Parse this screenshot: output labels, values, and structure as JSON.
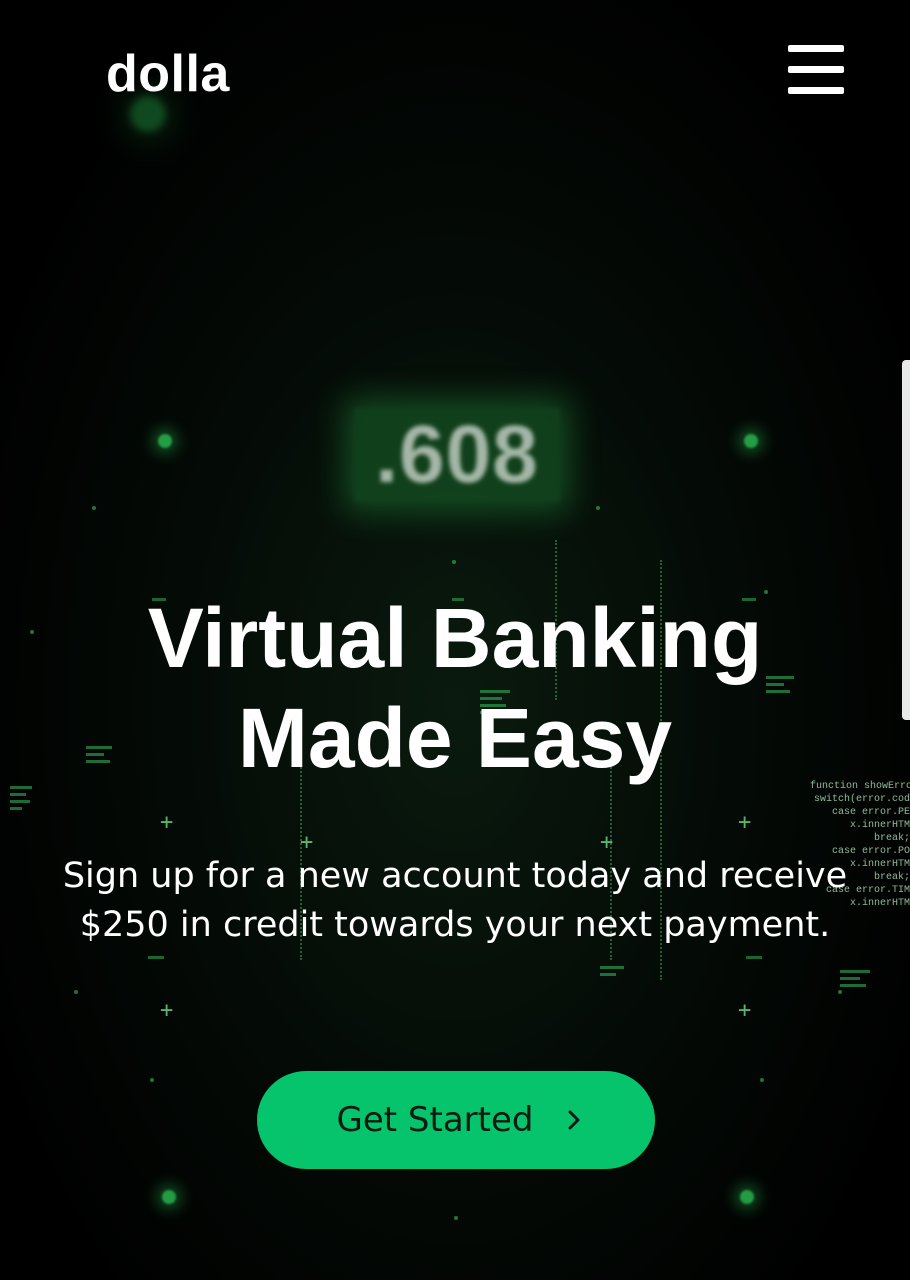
{
  "header": {
    "logo_text": "dolla",
    "menu_icon": "hamburger-menu-icon"
  },
  "background": {
    "ticker_text": ".608",
    "code_lines": [
      "function showErro",
      "switch(error.cod",
      "case error.PE",
      "x.innerHTM",
      "break;",
      "case error.PO",
      "x.innerHTM",
      "break;",
      "case error.TIM",
      "x.innerHTM"
    ]
  },
  "hero": {
    "title_line1": "Virtual Banking",
    "title_line2": "Made Easy",
    "subtitle": "Sign up for a new account today and receive $250 in credit towards your next payment.",
    "cta_label": "Get Started",
    "cta_icon": "chevron-right-icon"
  },
  "colors": {
    "accent": "#05c46b",
    "background": "#000000",
    "text": "#ffffff",
    "cta_text": "#0c1a12",
    "decor_green": "#2fd05a"
  }
}
